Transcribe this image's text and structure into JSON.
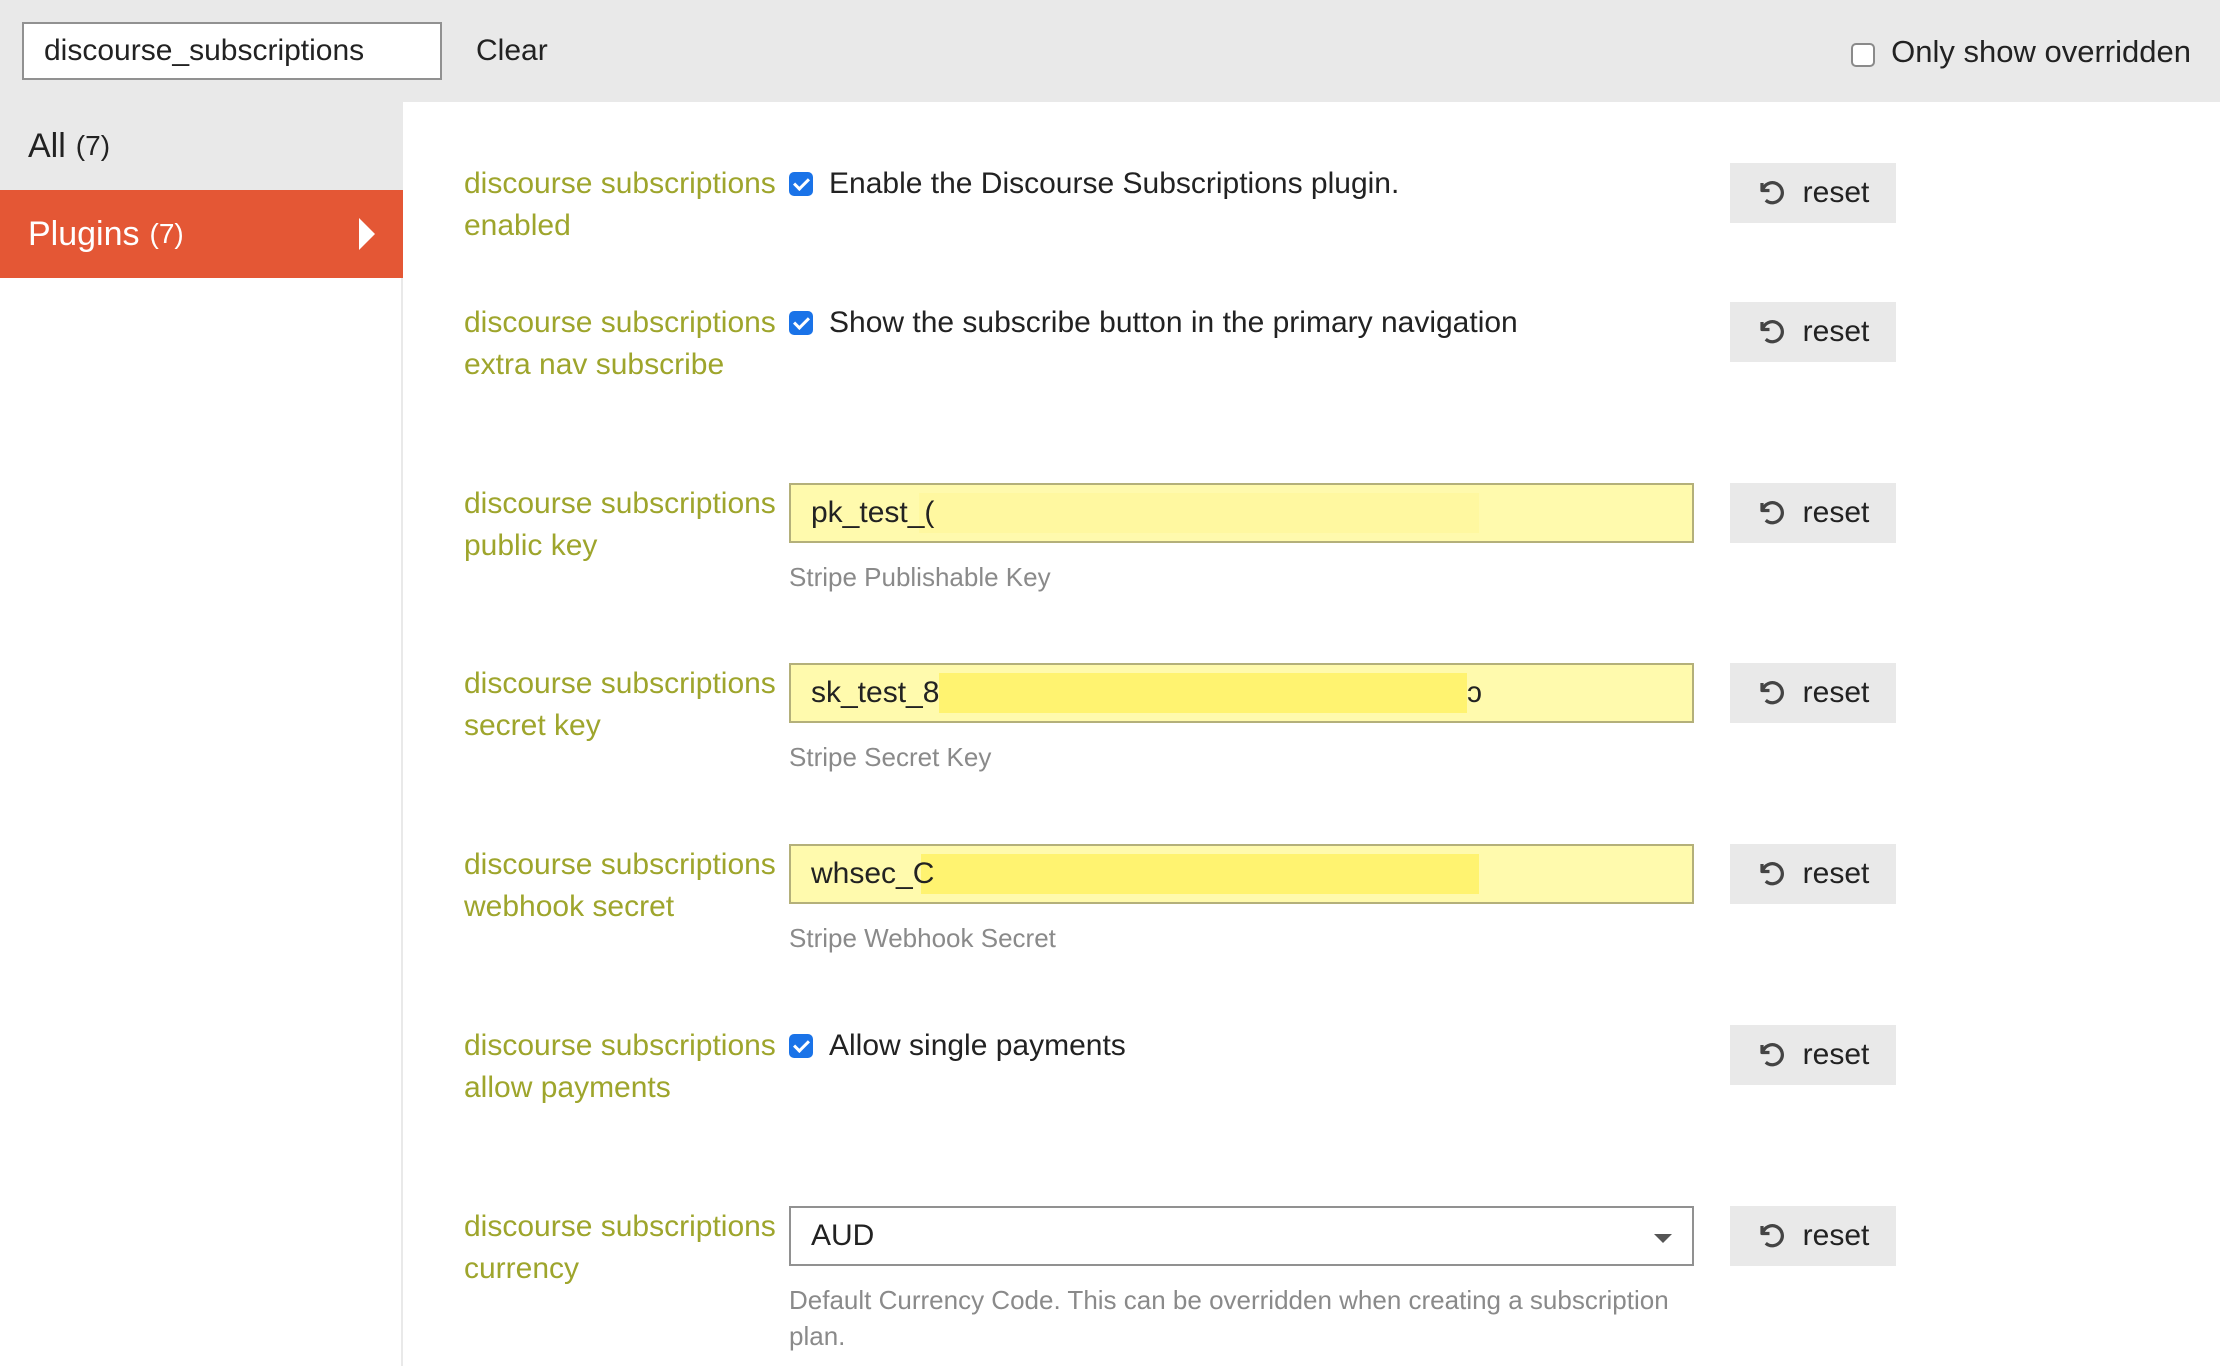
{
  "filter": {
    "search_value": "discourse_subscriptions",
    "clear_label": "Clear",
    "only_overridden_label": "Only show overridden",
    "only_overridden_checked": false
  },
  "sidebar": {
    "items": [
      {
        "label": "All",
        "count": "(7)",
        "active": false
      },
      {
        "label": "Plugins",
        "count": "(7)",
        "active": true
      }
    ],
    "active_color": "#e45735"
  },
  "settings": [
    {
      "name": "discourse subscriptions enabled",
      "type": "bool",
      "checked": true,
      "label": "Enable the Discourse Subscriptions plugin.",
      "reset_label": "reset"
    },
    {
      "name": "discourse subscriptions extra nav subscribe",
      "type": "bool",
      "checked": true,
      "label": "Show the subscribe button in the primary navigation",
      "reset_label": "reset"
    },
    {
      "name": "discourse subscriptions public key",
      "type": "string",
      "value": "pk_test_(",
      "description": "Stripe Publishable Key",
      "reset_label": "reset"
    },
    {
      "name": "discourse subscriptions secret key",
      "type": "string",
      "value": "sk_test_8",
      "value_tail": "ↄ",
      "description": "Stripe Secret Key",
      "reset_label": "reset"
    },
    {
      "name": "discourse subscriptions webhook secret",
      "type": "string",
      "value": "whsec_C",
      "description": "Stripe Webhook Secret",
      "reset_label": "reset"
    },
    {
      "name": "discourse subscriptions allow payments",
      "type": "bool",
      "checked": true,
      "label": "Allow single payments",
      "reset_label": "reset"
    },
    {
      "name": "discourse subscriptions currency",
      "type": "enum",
      "value": "AUD",
      "description": "Default Currency Code. This can be overridden when creating a subscription plan.",
      "reset_label": "reset"
    }
  ],
  "icons": {
    "reset": "undo-icon",
    "checkbox": "checkbox-icon",
    "dropdown": "chevron-down-icon",
    "caret": "caret-right-icon"
  },
  "colors": {
    "setting_name": "#9ea52c",
    "dirty_field_bg": "#fffaad",
    "checkbox": "#1a73e8",
    "button_bg": "#e9e9e9",
    "topbar_bg": "#e9e9e9"
  }
}
